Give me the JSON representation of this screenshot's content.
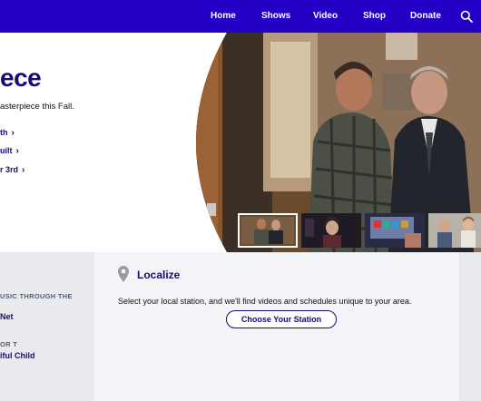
{
  "nav": {
    "items": [
      {
        "label": "Home"
      },
      {
        "label": "Shows"
      },
      {
        "label": "Video"
      },
      {
        "label": "Shop"
      },
      {
        "label": "Donate"
      }
    ],
    "search_icon": "search-icon"
  },
  "hero": {
    "title": "ece",
    "subtitle": "asterpiece this Fall.",
    "links": [
      {
        "label": "th"
      },
      {
        "label": "uilt"
      },
      {
        "label": "r 3rd"
      }
    ]
  },
  "thumbnails": [
    {
      "name": "thumbnail-1",
      "active": true
    },
    {
      "name": "thumbnail-2",
      "active": false
    },
    {
      "name": "thumbnail-3",
      "active": false
    },
    {
      "name": "thumbnail-4",
      "active": false
    }
  ],
  "sidebar": {
    "caption_1": "USIC THROUGH THE",
    "link_1": "Net",
    "caption_2": "OR T",
    "link_2": "iful Child"
  },
  "localize": {
    "title": "Localize",
    "description": "Select your local station, and we'll find videos and schedules unique to your area.",
    "button_label": "Choose Your Station",
    "icon": "location-pin-icon"
  },
  "colors": {
    "brand": "#2400c6",
    "link": "#1a0a6e",
    "panel": "#f3f4f8"
  }
}
